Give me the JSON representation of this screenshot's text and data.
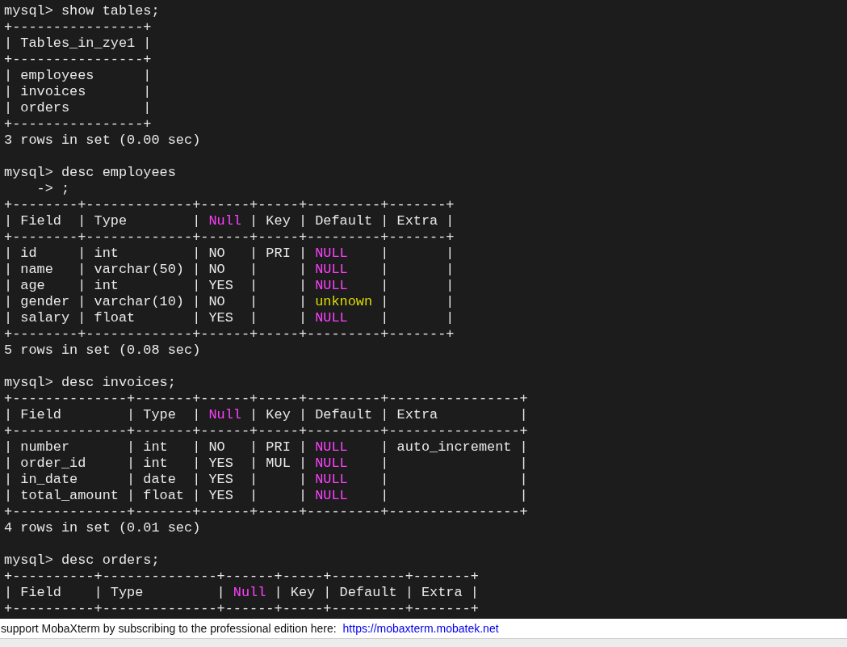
{
  "terminal": {
    "blocks": [
      {
        "lines": [
          {
            "segments": [
              {
                "text": "mysql> show tables;",
                "color": "#e8e8e8"
              }
            ]
          },
          {
            "segments": [
              {
                "text": "+----------------+",
                "color": "#e8e8e8"
              }
            ]
          },
          {
            "segments": [
              {
                "text": "| Tables_in_zye1 |",
                "color": "#e8e8e8"
              }
            ]
          },
          {
            "segments": [
              {
                "text": "+----------------+",
                "color": "#e8e8e8"
              }
            ]
          },
          {
            "segments": [
              {
                "text": "| employees      |",
                "color": "#e8e8e8"
              }
            ]
          },
          {
            "segments": [
              {
                "text": "| invoices       |",
                "color": "#e8e8e8"
              }
            ]
          },
          {
            "segments": [
              {
                "text": "| orders         |",
                "color": "#e8e8e8"
              }
            ]
          },
          {
            "segments": [
              {
                "text": "+----------------+",
                "color": "#e8e8e8"
              }
            ]
          },
          {
            "segments": [
              {
                "text": "3 rows in set (0.00 sec)",
                "color": "#e8e8e8"
              }
            ]
          }
        ]
      },
      {
        "lines": [
          {
            "segments": [
              {
                "text": "mysql> desc employees",
                "color": "#e8e8e8"
              }
            ]
          },
          {
            "segments": [
              {
                "text": "    -> ;",
                "color": "#e8e8e8"
              }
            ]
          },
          {
            "segments": [
              {
                "text": "+--------+-------------+------+-----+---------+-------+",
                "color": "#e8e8e8"
              }
            ]
          },
          {
            "segments": [
              {
                "text": "| Field  | Type        | ",
                "color": "#e8e8e8"
              },
              {
                "text": "Null",
                "color": "#ff40ff"
              },
              {
                "text": " | Key | Default | Extra |",
                "color": "#e8e8e8"
              }
            ]
          },
          {
            "segments": [
              {
                "text": "+--------+-------------+------+-----+---------+-------+",
                "color": "#e8e8e8"
              }
            ]
          },
          {
            "segments": [
              {
                "text": "| id     | int         | NO   | PRI | ",
                "color": "#e8e8e8"
              },
              {
                "text": "NULL",
                "color": "#ff40ff"
              },
              {
                "text": "    |       |",
                "color": "#e8e8e8"
              }
            ]
          },
          {
            "segments": [
              {
                "text": "| name   | varchar(50) | NO   |     | ",
                "color": "#e8e8e8"
              },
              {
                "text": "NULL",
                "color": "#ff40ff"
              },
              {
                "text": "    |       |",
                "color": "#e8e8e8"
              }
            ]
          },
          {
            "segments": [
              {
                "text": "| age    | int         | YES  |     | ",
                "color": "#e8e8e8"
              },
              {
                "text": "NULL",
                "color": "#ff40ff"
              },
              {
                "text": "    |       |",
                "color": "#e8e8e8"
              }
            ]
          },
          {
            "segments": [
              {
                "text": "| gender | varchar(10) | NO   |     | ",
                "color": "#e8e8e8"
              },
              {
                "text": "unknown",
                "color": "#dcdc00"
              },
              {
                "text": " |       |",
                "color": "#e8e8e8"
              }
            ]
          },
          {
            "segments": [
              {
                "text": "| salary | float       | YES  |     | ",
                "color": "#e8e8e8"
              },
              {
                "text": "NULL",
                "color": "#ff40ff"
              },
              {
                "text": "    |       |",
                "color": "#e8e8e8"
              }
            ]
          },
          {
            "segments": [
              {
                "text": "+--------+-------------+------+-----+---------+-------+",
                "color": "#e8e8e8"
              }
            ]
          },
          {
            "segments": [
              {
                "text": "5 rows in set (0.08 sec)",
                "color": "#e8e8e8"
              }
            ]
          }
        ]
      },
      {
        "lines": [
          {
            "segments": [
              {
                "text": "mysql> desc invoices;",
                "color": "#e8e8e8"
              }
            ]
          },
          {
            "segments": [
              {
                "text": "+--------------+-------+------+-----+---------+----------------+",
                "color": "#e8e8e8"
              }
            ]
          },
          {
            "segments": [
              {
                "text": "| Field        | Type  | ",
                "color": "#e8e8e8"
              },
              {
                "text": "Null",
                "color": "#ff40ff"
              },
              {
                "text": " | Key | Default | Extra          |",
                "color": "#e8e8e8"
              }
            ]
          },
          {
            "segments": [
              {
                "text": "+--------------+-------+------+-----+---------+----------------+",
                "color": "#e8e8e8"
              }
            ]
          },
          {
            "segments": [
              {
                "text": "| number       | int   | NO   | PRI | ",
                "color": "#e8e8e8"
              },
              {
                "text": "NULL",
                "color": "#ff40ff"
              },
              {
                "text": "    | auto_increment |",
                "color": "#e8e8e8"
              }
            ]
          },
          {
            "segments": [
              {
                "text": "| order_id     | int   | YES  | MUL | ",
                "color": "#e8e8e8"
              },
              {
                "text": "NULL",
                "color": "#ff40ff"
              },
              {
                "text": "    |                |",
                "color": "#e8e8e8"
              }
            ]
          },
          {
            "segments": [
              {
                "text": "| in_date      | date  | YES  |     | ",
                "color": "#e8e8e8"
              },
              {
                "text": "NULL",
                "color": "#ff40ff"
              },
              {
                "text": "    |                |",
                "color": "#e8e8e8"
              }
            ]
          },
          {
            "segments": [
              {
                "text": "| total_amount | float | YES  |     | ",
                "color": "#e8e8e8"
              },
              {
                "text": "NULL",
                "color": "#ff40ff"
              },
              {
                "text": "    |                |",
                "color": "#e8e8e8"
              }
            ]
          },
          {
            "segments": [
              {
                "text": "+--------------+-------+------+-----+---------+----------------+",
                "color": "#e8e8e8"
              }
            ]
          },
          {
            "segments": [
              {
                "text": "4 rows in set (0.01 sec)",
                "color": "#e8e8e8"
              }
            ]
          }
        ]
      },
      {
        "lines": [
          {
            "segments": [
              {
                "text": "mysql> desc orders;",
                "color": "#e8e8e8"
              }
            ]
          },
          {
            "segments": [
              {
                "text": "+----------+--------------+------+-----+---------+-------+",
                "color": "#e8e8e8"
              }
            ]
          },
          {
            "segments": [
              {
                "text": "| Field    | Type         | ",
                "color": "#e8e8e8"
              },
              {
                "text": "Null",
                "color": "#ff40ff"
              },
              {
                "text": " | Key | Default | Extra |",
                "color": "#e8e8e8"
              }
            ]
          },
          {
            "segments": [
              {
                "text": "+----------+--------------+------+-----+---------+-------+",
                "color": "#e8e8e8"
              }
            ]
          }
        ]
      }
    ]
  },
  "support_bar": {
    "message": "support MobaXterm by subscribing to the professional edition here:",
    "link": "https://mobaxterm.mobatek.net"
  }
}
